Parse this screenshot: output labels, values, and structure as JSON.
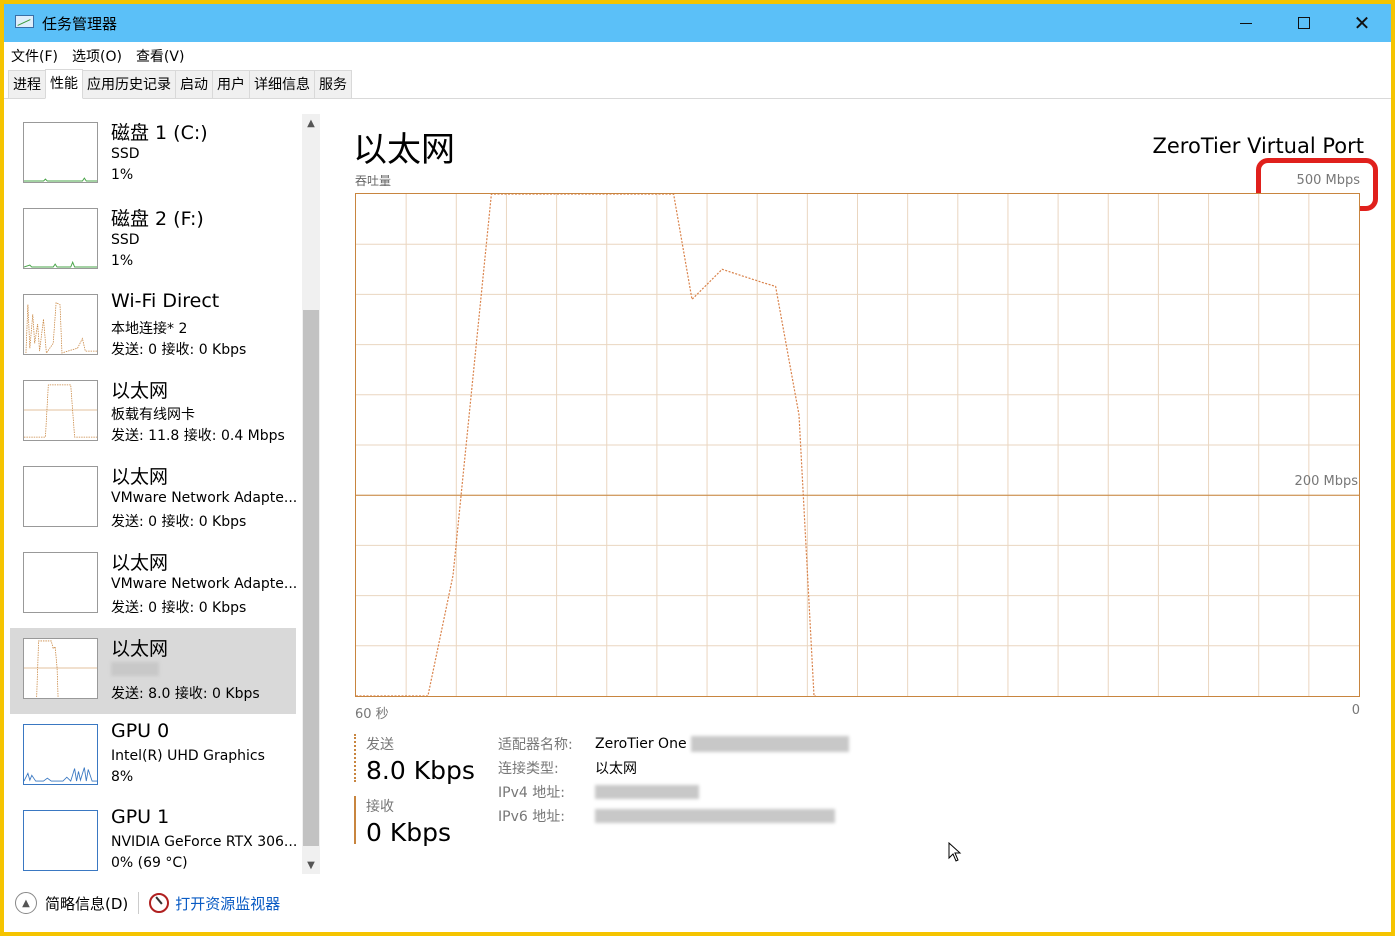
{
  "window": {
    "title": "任务管理器"
  },
  "menu": [
    "文件(F)",
    "选项(O)",
    "查看(V)"
  ],
  "tabs": [
    "进程",
    "性能",
    "应用历史记录",
    "启动",
    "用户",
    "详细信息",
    "服务"
  ],
  "sidebar": {
    "items": [
      {
        "name": "磁盘 1 (C:)",
        "sub": "SSD",
        "stat": "1%"
      },
      {
        "name": "磁盘 2 (F:)",
        "sub": "SSD",
        "stat": "1%"
      },
      {
        "name": "Wi-Fi Direct",
        "sub": "本地连接* 2",
        "stat": "发送: 0 接收: 0 Kbps"
      },
      {
        "name": "以太网",
        "sub": "板载有线网卡",
        "stat": "发送: 11.8 接收: 0.4 Mbps"
      },
      {
        "name": "以太网",
        "sub": "VMware Network Adapte...",
        "stat": "发送: 0 接收: 0 Kbps"
      },
      {
        "name": "以太网",
        "sub": "VMware Network Adapte...",
        "stat": "发送: 0 接收: 0 Kbps"
      },
      {
        "name": "以太网",
        "sub": "",
        "stat": "发送: 8.0 接收: 0 Kbps"
      },
      {
        "name": "GPU 0",
        "sub": "Intel(R) UHD Graphics",
        "stat": "8%"
      },
      {
        "name": "GPU 1",
        "sub": "NVIDIA GeForce RTX 306...",
        "stat": "0% (69 °C)"
      }
    ]
  },
  "main": {
    "title": "以太网",
    "adapter": "ZeroTier Virtual Port",
    "throughput_label": "吞吐量",
    "max_label": "500 Mbps",
    "mid_label": "200 Mbps",
    "x_left": "60 秒",
    "x_right": "0",
    "send_label": "发送",
    "send_value": "8.0 Kbps",
    "recv_label": "接收",
    "recv_value": "0 Kbps",
    "info": {
      "adapter_key": "适配器名称:",
      "adapter_val": "ZeroTier One",
      "conn_key": "连接类型:",
      "conn_val": "以太网",
      "ipv4_key": "IPv4 地址:",
      "ipv6_key": "IPv6 地址:"
    }
  },
  "footer": {
    "fewer": "简略信息(D)",
    "monitor": "打开资源监视器"
  },
  "colors": {
    "titlebar": "#5bc0f8",
    "border": "#f5c400",
    "graph": "#c8853f",
    "highlight": "#e0201c",
    "link": "#0a5bc4"
  },
  "chart_data": {
    "type": "line",
    "title": "吞吐量",
    "xlabel": "",
    "ylabel": "",
    "xlim": [
      60,
      0
    ],
    "ylim": [
      0,
      500
    ],
    "series": [
      {
        "name": "发送",
        "style": "dashed",
        "x": [
          60,
          55.7,
          54.2,
          51.9,
          41,
          39.9,
          38.1,
          35.7,
          34.9,
          33.5,
          32.6,
          32.5
        ],
        "y": [
          0,
          0,
          120,
          500,
          500,
          395,
          425,
          412,
          408,
          280,
          0,
          0
        ]
      }
    ]
  }
}
